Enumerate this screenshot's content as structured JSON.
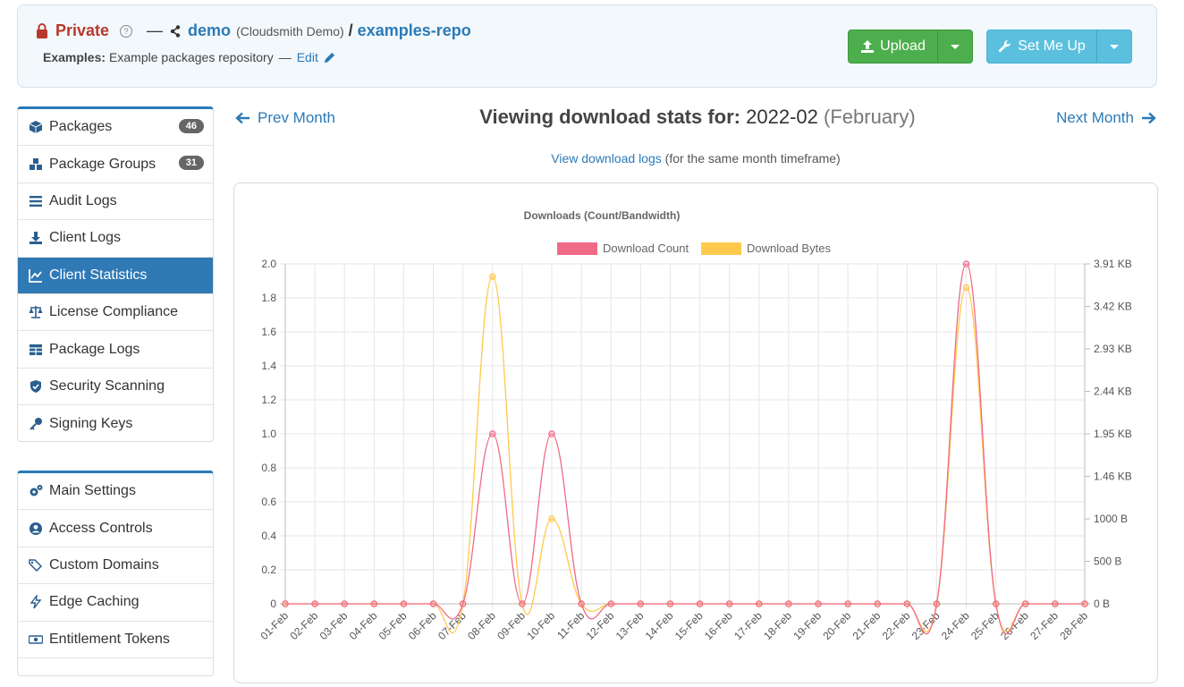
{
  "header": {
    "visibility": "Private",
    "help_icon_label": "?",
    "dash": "—",
    "org": "demo",
    "org_name": "(Cloudsmith Demo)",
    "slash": "/",
    "repo": "examples-repo",
    "desc_label": "Examples:",
    "desc_text": "Example packages repository",
    "edit_dash": "—",
    "edit_label": "Edit"
  },
  "buttons": {
    "upload": "Upload",
    "setup": "Set Me Up"
  },
  "sidebar": {
    "items": [
      {
        "label": "Packages",
        "badge": "46",
        "icon": "cube-icon"
      },
      {
        "label": "Package Groups",
        "badge": "31",
        "icon": "cubes-icon"
      },
      {
        "label": "Audit Logs",
        "icon": "list-icon"
      },
      {
        "label": "Client Logs",
        "icon": "download-icon"
      },
      {
        "label": "Client Statistics",
        "icon": "chart-line-icon",
        "active": true
      },
      {
        "label": "License Compliance",
        "icon": "balance-scale-icon"
      },
      {
        "label": "Package Logs",
        "icon": "table-icon"
      },
      {
        "label": "Security Scanning",
        "icon": "shield-icon"
      },
      {
        "label": "Signing Keys",
        "icon": "key-icon"
      }
    ],
    "settings": [
      {
        "label": "Main Settings",
        "icon": "cogs-icon"
      },
      {
        "label": "Access Controls",
        "icon": "user-circle-icon"
      },
      {
        "label": "Custom Domains",
        "icon": "tags-icon"
      },
      {
        "label": "Edge Caching",
        "icon": "bolt-icon"
      },
      {
        "label": "Entitlement Tokens",
        "icon": "money-icon"
      }
    ]
  },
  "main": {
    "prev": "Prev Month",
    "next": "Next Month",
    "title_label": "Viewing download stats for:",
    "title_period": "2022-02",
    "title_month": "(February)",
    "logs_link": "View download logs",
    "logs_note": "(for the same month timeframe)"
  },
  "colors": {
    "count": "#f06a87",
    "bytes": "#ffc94d",
    "accent": "#2a7ab8"
  },
  "chart_data": {
    "type": "line",
    "title": "Downloads (Count/Bandwidth)",
    "legend_position": "top",
    "grid": true,
    "categories": [
      "01-Feb",
      "02-Feb",
      "03-Feb",
      "04-Feb",
      "05-Feb",
      "06-Feb",
      "07-Feb",
      "08-Feb",
      "09-Feb",
      "10-Feb",
      "11-Feb",
      "12-Feb",
      "13-Feb",
      "14-Feb",
      "15-Feb",
      "16-Feb",
      "17-Feb",
      "18-Feb",
      "19-Feb",
      "20-Feb",
      "21-Feb",
      "22-Feb",
      "23-Feb",
      "24-Feb",
      "25-Feb",
      "26-Feb",
      "27-Feb",
      "28-Feb"
    ],
    "series": [
      {
        "name": "Download Count",
        "axis": "left",
        "values": [
          0,
          0,
          0,
          0,
          0,
          0,
          0,
          1,
          0,
          1,
          0,
          0,
          0,
          0,
          0,
          0,
          0,
          0,
          0,
          0,
          0,
          0,
          0,
          2,
          0,
          0,
          0,
          0
        ]
      },
      {
        "name": "Download Bytes",
        "axis": "right",
        "values": [
          0,
          0,
          0,
          0,
          0,
          0,
          0,
          3850,
          0,
          1000,
          0,
          0,
          0,
          0,
          0,
          0,
          0,
          0,
          0,
          0,
          0,
          0,
          0,
          3720,
          0,
          0,
          0,
          0
        ]
      }
    ],
    "ylim_left": [
      0,
      2.0
    ],
    "yticks_left": [
      "0",
      "0.2",
      "0.4",
      "0.6",
      "0.8",
      "1.0",
      "1.2",
      "1.4",
      "1.6",
      "1.8",
      "2.0"
    ],
    "ylim_right": [
      0,
      4000
    ],
    "yticks_right": [
      "0 B",
      "500 B",
      "1000 B",
      "1.46 KB",
      "1.95 KB",
      "2.44 KB",
      "2.93 KB",
      "3.42 KB",
      "3.91 KB"
    ]
  }
}
